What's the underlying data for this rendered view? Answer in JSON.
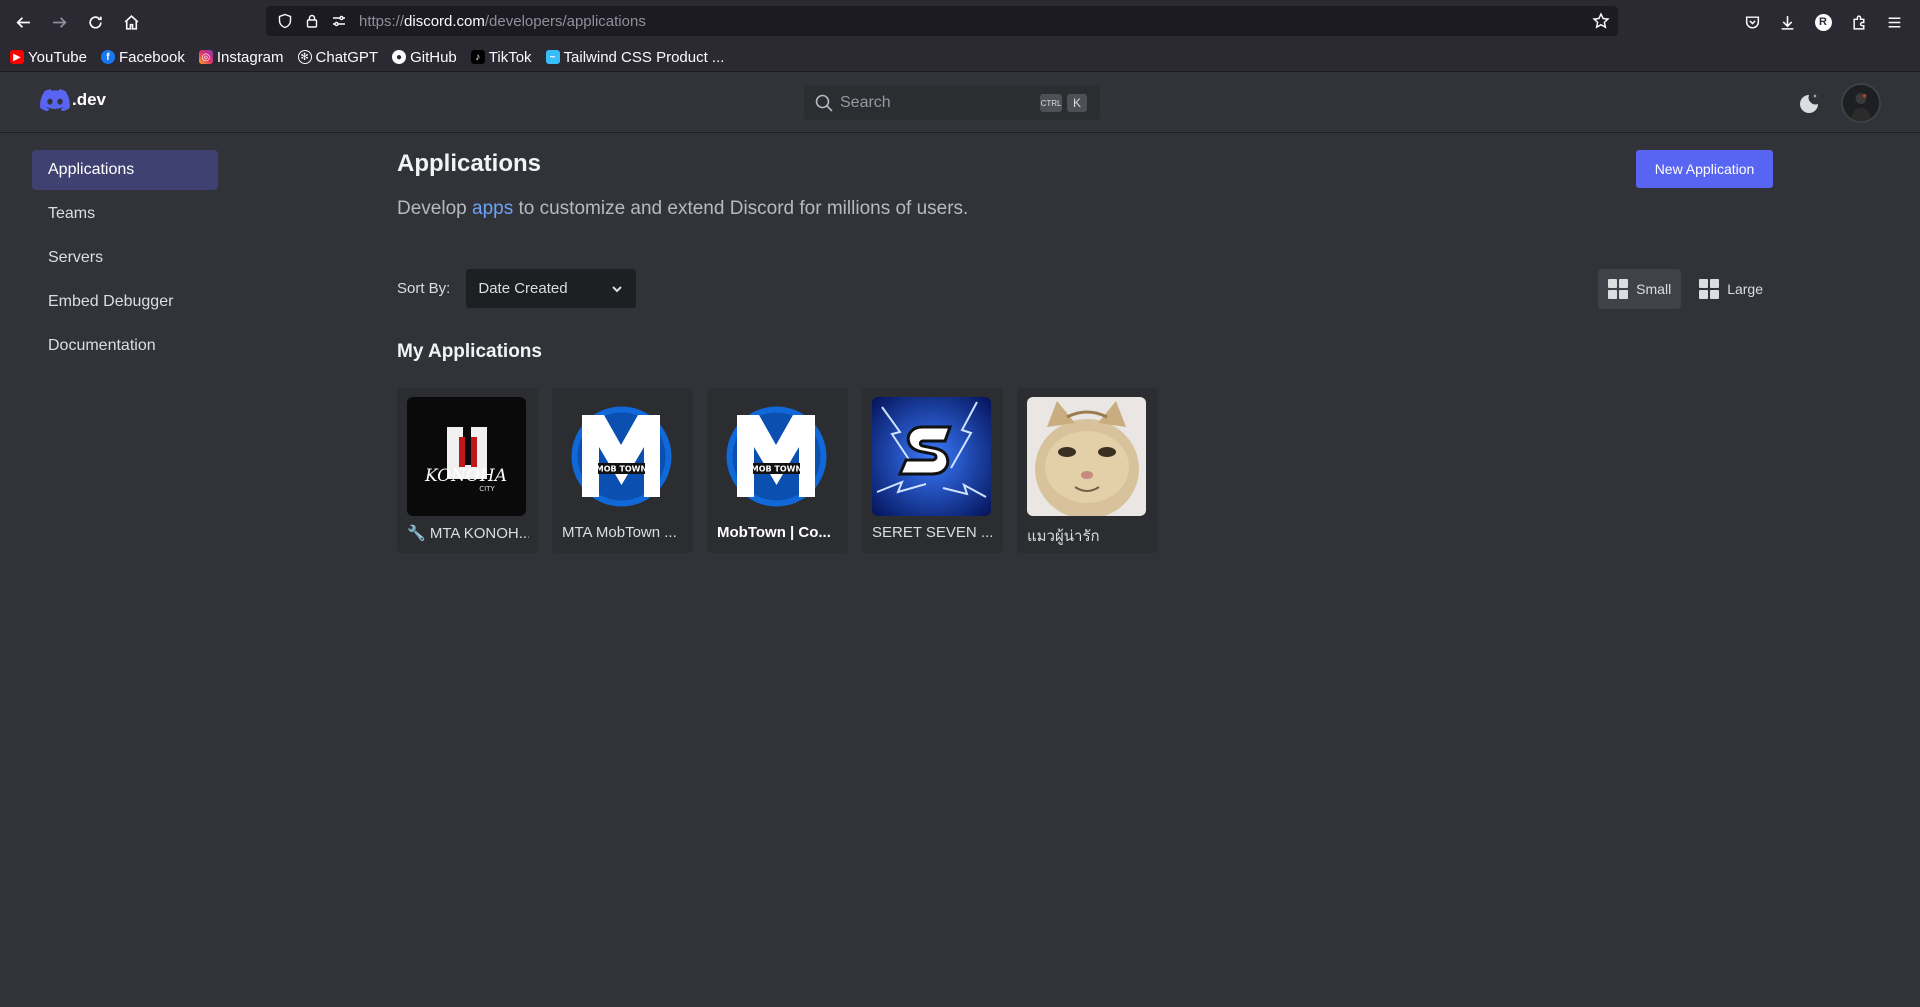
{
  "browser": {
    "url_prefix": "https://",
    "url_host": "discord.com",
    "url_path": "/developers/applications",
    "profile_initial": "R",
    "bookmarks": [
      {
        "label": "YouTube",
        "icon": "youtube-icon",
        "color": "#ff0000"
      },
      {
        "label": "Facebook",
        "icon": "facebook-icon",
        "color": "#1877f2"
      },
      {
        "label": "Instagram",
        "icon": "instagram-icon",
        "color": "#e1306c"
      },
      {
        "label": "ChatGPT",
        "icon": "chatgpt-icon",
        "color": "#2b2a33"
      },
      {
        "label": "GitHub",
        "icon": "github-icon",
        "color": "#2b2a33"
      },
      {
        "label": "TikTok",
        "icon": "tiktok-icon",
        "color": "#000000"
      },
      {
        "label": "Tailwind CSS Product ...",
        "icon": "tailwind-icon",
        "color": "#38bdf8"
      }
    ]
  },
  "header": {
    "logo_text": ".dev",
    "search_placeholder": "Search",
    "shortcut_ctrl": "CTRL",
    "shortcut_key": "K"
  },
  "sidebar": {
    "items": [
      {
        "label": "Applications",
        "active": true
      },
      {
        "label": "Teams",
        "active": false
      },
      {
        "label": "Servers",
        "active": false
      },
      {
        "label": "Embed Debugger",
        "active": false
      },
      {
        "label": "Documentation",
        "active": false
      }
    ]
  },
  "main": {
    "title": "Applications",
    "new_app_label": "New Application",
    "subtitle_pre": "Develop ",
    "subtitle_link": "apps",
    "subtitle_post": " to customize and extend Discord for millions of users.",
    "sort_label": "Sort By:",
    "sort_value": "Date Created",
    "view_small": "Small",
    "view_large": "Large",
    "section_title": "My Applications",
    "apps": [
      {
        "name": "🔧 MTA KONOH...",
        "image": "konoha-city-logo",
        "bold": false
      },
      {
        "name": "MTA MobTown ...",
        "image": "mta-mobtown-logo",
        "bold": false
      },
      {
        "name": "MobTown | Co...",
        "image": "mta-mobtown-logo",
        "bold": true
      },
      {
        "name": "SERET SEVEN ...",
        "image": "lightning-s-logo",
        "bold": false
      },
      {
        "name": "แมวผู้น่ารัก",
        "image": "cat-photo",
        "bold": false
      }
    ]
  },
  "colors": {
    "accent": "#5865f2",
    "background": "#313338",
    "link": "#6ea2f5"
  }
}
